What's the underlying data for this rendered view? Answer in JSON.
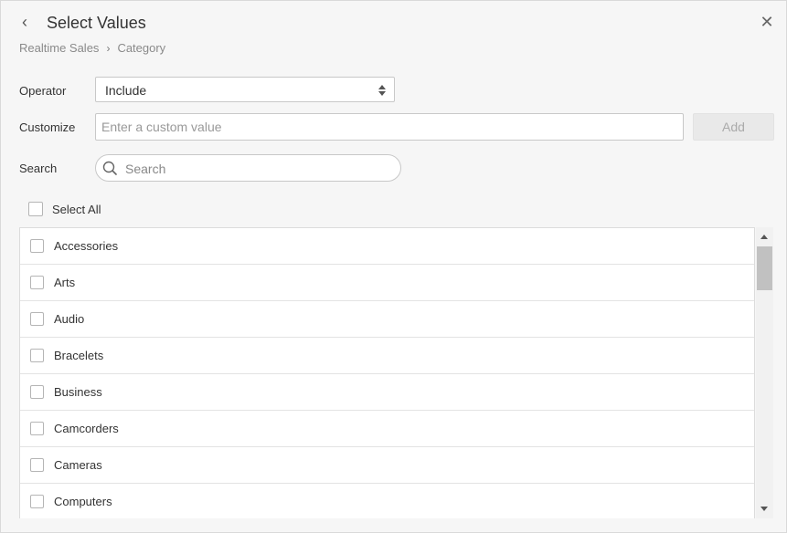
{
  "header": {
    "title": "Select Values",
    "back_icon": "chevron-left-icon",
    "close_icon": "close-icon",
    "close_glyph": "✕",
    "back_glyph": "‹"
  },
  "breadcrumb": {
    "items": [
      "Realtime Sales",
      "Category"
    ],
    "separator": "›"
  },
  "operator": {
    "label": "Operator",
    "value": "Include"
  },
  "customize": {
    "label": "Customize",
    "placeholder": "Enter a custom value",
    "value": "",
    "add_label": "Add"
  },
  "search": {
    "label": "Search",
    "placeholder": "Search",
    "value": ""
  },
  "select_all": {
    "label": "Select All",
    "checked": false
  },
  "items": [
    {
      "label": "Accessories",
      "checked": false
    },
    {
      "label": "Arts",
      "checked": false
    },
    {
      "label": "Audio",
      "checked": false
    },
    {
      "label": "Bracelets",
      "checked": false
    },
    {
      "label": "Business",
      "checked": false
    },
    {
      "label": "Camcorders",
      "checked": false
    },
    {
      "label": "Cameras",
      "checked": false
    },
    {
      "label": "Computers",
      "checked": false
    }
  ],
  "colors": {
    "background": "#f6f6f6",
    "border": "#c8c8c8",
    "text": "#333333",
    "muted": "#8a8a8a"
  }
}
